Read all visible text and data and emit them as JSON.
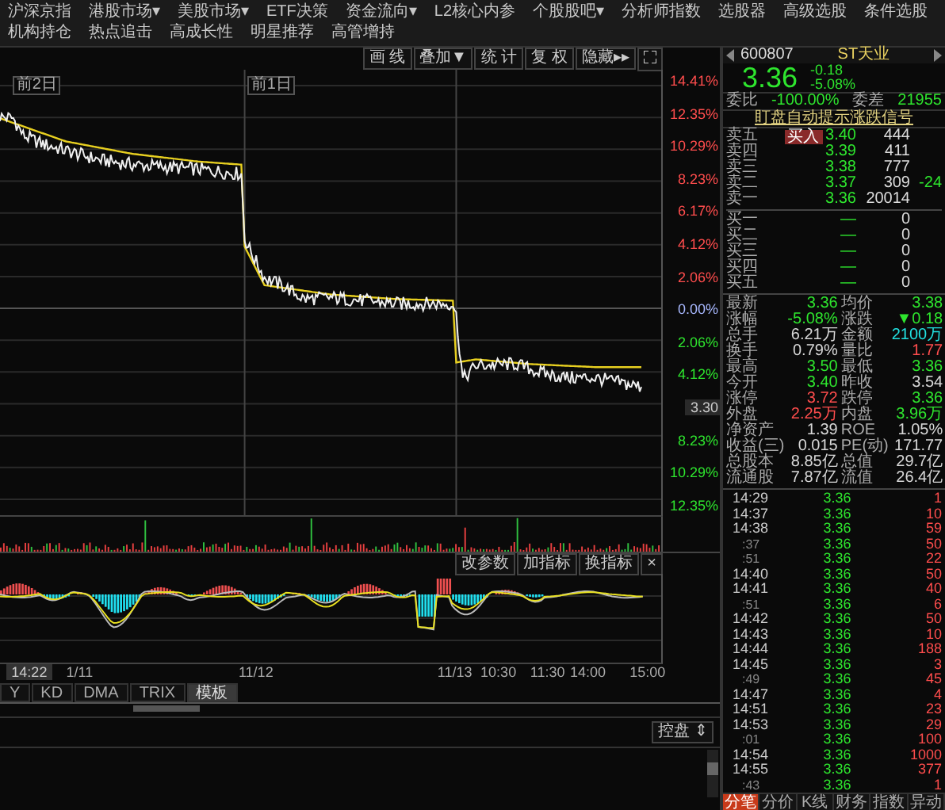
{
  "menu": [
    "沪深京指",
    "港股市场▾",
    "美股市场▾",
    "ETF决策",
    "资金流向▾",
    "L2核心内参",
    "个股股吧▾",
    "分析师指数",
    "选股器",
    "高级选股",
    "条件选股",
    "机构持仓",
    "热点追击",
    "高成长性",
    "明星推荐",
    "高管增持"
  ],
  "chart_toolbar": [
    "画 线",
    "叠加▼",
    "统 计",
    "复 权",
    "隐藏▸▸"
  ],
  "price_chart": {
    "day_labels": [
      "前2日",
      "前1日"
    ],
    "axis_labels": [
      {
        "kind": "percent",
        "text": "14.41%",
        "color": "#ff4d4d"
      },
      {
        "kind": "percent",
        "text": "12.35%",
        "color": "#ff4d4d"
      },
      {
        "kind": "percent",
        "text": "10.29%",
        "color": "#ff4d4d"
      },
      {
        "kind": "percent",
        "text": "8.23%",
        "color": "#ff4d4d"
      },
      {
        "kind": "percent",
        "text": "6.17%",
        "color": "#ff4d4d"
      },
      {
        "kind": "percent",
        "text": "4.12%",
        "color": "#ff4d4d"
      },
      {
        "kind": "percent",
        "text": "2.06%",
        "color": "#ff4d4d"
      },
      {
        "kind": "percent",
        "text": "0.00%",
        "color": "#a8b8ff"
      },
      {
        "kind": "percent",
        "text": "2.06%",
        "color": "#2ee52e"
      },
      {
        "kind": "percent",
        "text": "4.12%",
        "color": "#2ee52e"
      },
      {
        "kind": "price_tag",
        "text": "3.30"
      },
      {
        "kind": "percent",
        "text": "8.23%",
        "color": "#2ee52e"
      },
      {
        "kind": "percent",
        "text": "10.29%",
        "color": "#2ee52e"
      },
      {
        "kind": "percent",
        "text": "12.35%",
        "color": "#2ee52e"
      }
    ]
  },
  "indicator_buttons": [
    "改参数",
    "加指标",
    "换指标",
    "×"
  ],
  "time_axis": {
    "cursor_time": "14:22",
    "labels": [
      "1/11",
      "11/12",
      "11/13",
      "10:30",
      "11:30",
      "14:00",
      "15:00"
    ]
  },
  "indicator_tabs": [
    {
      "label": "Y",
      "selected": false
    },
    {
      "label": "KD",
      "selected": false
    },
    {
      "label": "DMA",
      "selected": false
    },
    {
      "label": "TRIX",
      "selected": false
    },
    {
      "label": "模板",
      "selected": true
    }
  ],
  "bottom_panel": {
    "button": "控盘 ⇕"
  },
  "quote": {
    "code": "600807",
    "name": "ST天业",
    "price": "3.36",
    "change": "-0.18",
    "change_pct": "-5.08%",
    "wei_bi_label": "委比",
    "wei_bi": "-100.00%",
    "wei_cha_label": "委差",
    "wei_cha": "21955",
    "signal_link": "盯盘自动提示涨跌信号",
    "buy_button": "买入"
  },
  "order_book": [
    {
      "label": "卖五",
      "price": "3.40",
      "volume": "444"
    },
    {
      "label": "卖四",
      "price": "3.39",
      "volume": "411"
    },
    {
      "label": "卖三",
      "price": "3.38",
      "volume": "777"
    },
    {
      "label": "卖二",
      "price": "3.37",
      "volume": "309",
      "change": "-24"
    },
    {
      "label": "卖一",
      "price": "3.36",
      "volume": "20014"
    },
    {
      "label": "买一",
      "price": "—",
      "volume": "0"
    },
    {
      "label": "买二",
      "price": "—",
      "volume": "0"
    },
    {
      "label": "买三",
      "price": "—",
      "volume": "0"
    },
    {
      "label": "买四",
      "price": "—",
      "volume": "0"
    },
    {
      "label": "买五",
      "price": "—",
      "volume": "0"
    }
  ],
  "stats": [
    {
      "label": "最新",
      "value": "3.36",
      "color": "#2ee52e"
    },
    {
      "label": "均价",
      "value": "3.38",
      "color": "#2ee52e"
    },
    {
      "label": "涨幅",
      "value": "-5.08%",
      "color": "#2ee52e"
    },
    {
      "label": "涨跌",
      "value": "▼0.18",
      "color": "#2ee52e"
    },
    {
      "label": "总手",
      "value": "6.21万",
      "color": "#d8d8d8"
    },
    {
      "label": "金额",
      "value": "2100万",
      "color": "#22e0e0"
    },
    {
      "label": "换手",
      "value": "0.79%",
      "color": "#d8d8d8"
    },
    {
      "label": "量比",
      "value": "1.77",
      "color": "#ff4d4d"
    },
    {
      "label": "最高",
      "value": "3.50",
      "color": "#2ee52e"
    },
    {
      "label": "最低",
      "value": "3.36",
      "color": "#2ee52e"
    },
    {
      "label": "今开",
      "value": "3.40",
      "color": "#2ee52e"
    },
    {
      "label": "昨收",
      "value": "3.54",
      "color": "#d8d8d8"
    },
    {
      "label": "涨停",
      "value": "3.72",
      "color": "#ff4d4d"
    },
    {
      "label": "跌停",
      "value": "3.36",
      "color": "#2ee52e"
    },
    {
      "label": "外盘",
      "value": "2.25万",
      "color": "#ff4d4d"
    },
    {
      "label": "内盘",
      "value": "3.96万",
      "color": "#2ee52e"
    },
    {
      "label": "净资产",
      "value": "1.39",
      "color": "#d8d8d8"
    },
    {
      "label": "ROE",
      "value": "1.05%",
      "color": "#d8d8d8"
    },
    {
      "label": "收益(三)",
      "value": "0.015",
      "color": "#d8d8d8"
    },
    {
      "label": "PE(动)",
      "value": "171.77",
      "color": "#d8d8d8"
    },
    {
      "label": "总股本",
      "value": "8.85亿",
      "color": "#d8d8d8"
    },
    {
      "label": "总值",
      "value": "29.7亿",
      "color": "#d8d8d8"
    },
    {
      "label": "流通股",
      "value": "7.87亿",
      "color": "#d8d8d8"
    },
    {
      "label": "流值",
      "value": "26.4亿",
      "color": "#d8d8d8"
    }
  ],
  "ticks": [
    {
      "time": "14:29",
      "continued": false,
      "price": "3.36",
      "volume": "1"
    },
    {
      "time": "14:37",
      "continued": false,
      "price": "3.36",
      "volume": "10"
    },
    {
      "time": "14:38",
      "continued": false,
      "price": "3.36",
      "volume": "59"
    },
    {
      "time": ":37",
      "continued": true,
      "price": "3.36",
      "volume": "50"
    },
    {
      "time": ":51",
      "continued": true,
      "price": "3.36",
      "volume": "22"
    },
    {
      "time": "14:40",
      "continued": false,
      "price": "3.36",
      "volume": "50"
    },
    {
      "time": "14:41",
      "continued": false,
      "price": "3.36",
      "volume": "40"
    },
    {
      "time": ":51",
      "continued": true,
      "price": "3.36",
      "volume": "6"
    },
    {
      "time": "14:42",
      "continued": false,
      "price": "3.36",
      "volume": "50"
    },
    {
      "time": "14:43",
      "continued": false,
      "price": "3.36",
      "volume": "10"
    },
    {
      "time": "14:44",
      "continued": false,
      "price": "3.36",
      "volume": "188"
    },
    {
      "time": "14:45",
      "continued": false,
      "price": "3.36",
      "volume": "3"
    },
    {
      "time": ":49",
      "continued": true,
      "price": "3.36",
      "volume": "45"
    },
    {
      "time": "14:47",
      "continued": false,
      "price": "3.36",
      "volume": "4"
    },
    {
      "time": "14:51",
      "continued": false,
      "price": "3.36",
      "volume": "23"
    },
    {
      "time": "14:53",
      "continued": false,
      "price": "3.36",
      "volume": "29"
    },
    {
      "time": ":01",
      "continued": true,
      "price": "3.36",
      "volume": "100"
    },
    {
      "time": "14:54",
      "continued": false,
      "price": "3.36",
      "volume": "1000"
    },
    {
      "time": "14:55",
      "continued": false,
      "price": "3.36",
      "volume": "377"
    },
    {
      "time": ":43",
      "continued": true,
      "price": "3.36",
      "volume": "1"
    }
  ],
  "bottom_tabs": [
    {
      "label": "分笔",
      "selected": true
    },
    {
      "label": "分价",
      "selected": false
    },
    {
      "label": "K线",
      "selected": false
    },
    {
      "label": "财务",
      "selected": false
    },
    {
      "label": "指数",
      "selected": false
    },
    {
      "label": "异动",
      "selected": false
    }
  ]
}
